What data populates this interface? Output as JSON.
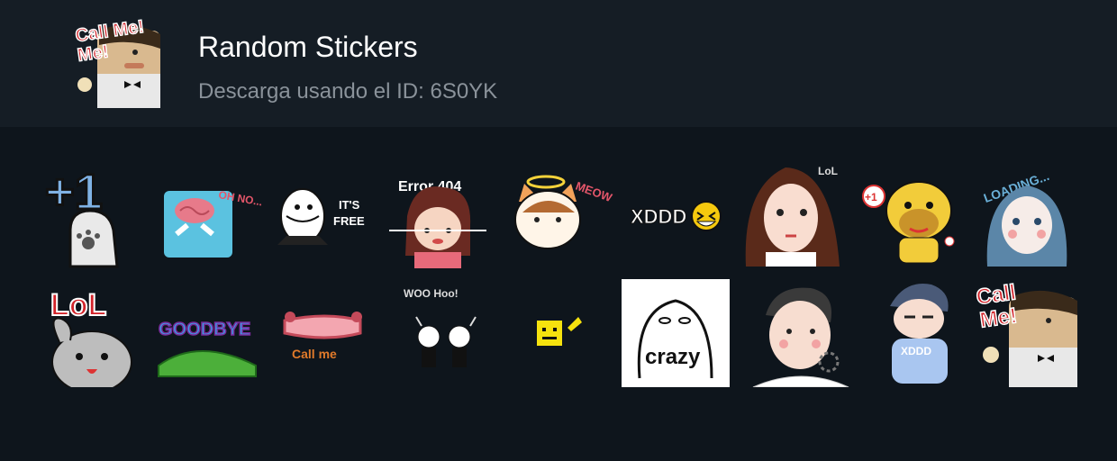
{
  "pack": {
    "title": "Random Stickers",
    "subtitle": "Descarga usando el ID: 6S0YK",
    "icon": "call-me-sticker"
  },
  "colors": {
    "background": "#0e151c",
    "header_background": "#151d25",
    "title": "#ffffff",
    "subtitle": "#8a929a"
  },
  "stickers": [
    {
      "name": "plus-one-ghost",
      "text": "+1"
    },
    {
      "name": "brain-oh-no",
      "text": "OH NO..."
    },
    {
      "name": "its-free",
      "text": "IT'S FREE"
    },
    {
      "name": "error-404-girl",
      "text": "Error 404"
    },
    {
      "name": "angel-cat-meow",
      "text": "MEOW"
    },
    {
      "name": "xddd-laugh",
      "text": "XDDD"
    },
    {
      "name": "lol-girl",
      "text": "LoL"
    },
    {
      "name": "plus-one-dog",
      "text": "+1"
    },
    {
      "name": "loading-girl",
      "text": "LOADING..."
    },
    {
      "name": "lol-bunny",
      "text": "LoL"
    },
    {
      "name": "goodbye-hill",
      "text": "GOODBYE"
    },
    {
      "name": "call-me-phone",
      "text": "Call me"
    },
    {
      "name": "woo-hoo-kids",
      "text": "WOO Hoo!"
    },
    {
      "name": "pixel-smiley",
      "text": ""
    },
    {
      "name": "crazy-ghost",
      "text": "crazy"
    },
    {
      "name": "boy-loading",
      "text": ""
    },
    {
      "name": "xddd-boy",
      "text": "XDDD"
    },
    {
      "name": "call-me-man",
      "text": "Call Me!"
    }
  ]
}
